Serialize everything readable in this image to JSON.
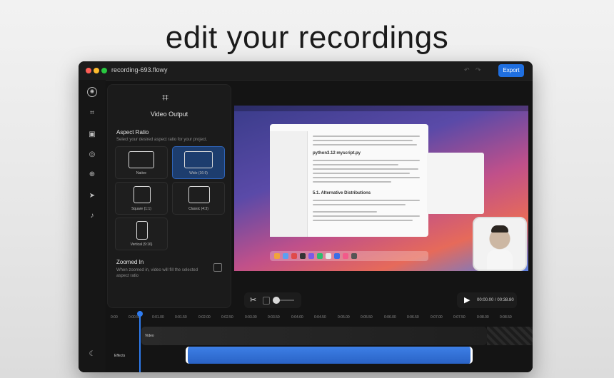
{
  "headline": "edit your recordings",
  "window": {
    "title": "recording-693.flowy",
    "export_label": "Export"
  },
  "sidebar": {
    "icons": [
      "app-logo-icon",
      "crop-icon",
      "image-icon",
      "camera-icon",
      "zoom-icon",
      "cursor-icon",
      "audio-icon",
      "theme-icon"
    ]
  },
  "panel": {
    "title": "Video Output",
    "aspect_ratio": {
      "title": "Aspect Ratio",
      "subtitle": "Select your desired aspect ratio for your project.",
      "options": [
        "Native",
        "Wide (16:9)",
        "Square (1:1)",
        "Classic (4:3)",
        "Vertical (9:16)"
      ],
      "selected": "Wide (16:9)"
    },
    "zoomed_in": {
      "title": "Zoomed In",
      "description": "When zoomed in, video will fill the selected aspect ratio",
      "checked": false
    }
  },
  "preview": {
    "doc_heading_1": "python3.12 myscript.py",
    "doc_heading_2": "5.1. Alternative Distributions"
  },
  "playback": {
    "time": "00:00.00 / 00:38.80"
  },
  "timeline": {
    "ticks": [
      "0:00",
      "0:00.50",
      "0:01.00",
      "0:01.50",
      "0:02.00",
      "0:02.50",
      "0:03.00",
      "0:03.50",
      "0:04.00",
      "0:04.50",
      "0:05.00",
      "0:05.50",
      "0:06.00",
      "0:06.50",
      "0:07.00",
      "0:07.50",
      "0:08.00",
      "0:08.50"
    ],
    "tracks": {
      "video": "Video",
      "effects": "Effects"
    }
  },
  "colors": {
    "accent": "#1f6fe0",
    "window_bg": "#141414"
  }
}
